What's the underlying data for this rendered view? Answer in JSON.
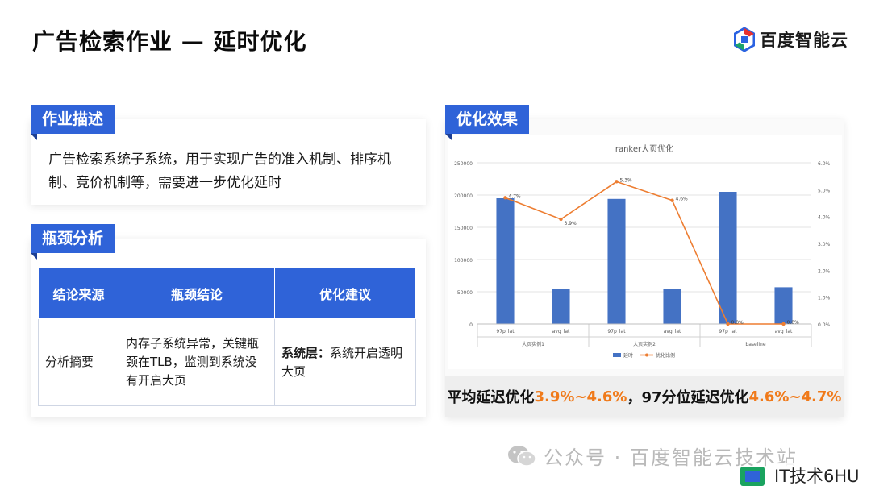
{
  "header": {
    "title": "广告检索作业 — 延时优化"
  },
  "brand": {
    "name": "百度智能云",
    "colors": [
      "#e8312f",
      "#2a62e2",
      "#1ca36b"
    ]
  },
  "description": {
    "tag": "作业描述",
    "text": "广告检索系统子系统，用于实现广告的准入机制、排序机制、竞价机制等，需要进一步优化延时"
  },
  "bottleneck": {
    "tag": "瓶颈分析",
    "headers": [
      "结论来源",
      "瓶颈结论",
      "优化建议"
    ],
    "row": {
      "source": "分析摘要",
      "conclusion": "内存子系统异常，关键瓶颈在TLB，监测到系统没有开启大页",
      "advice_bold": "系统层：",
      "advice_text": "系统开启透明大页"
    }
  },
  "effect": {
    "tag": "优化效果",
    "summary": {
      "p1": "平均延迟优化",
      "v1": "3.9%~4.6%",
      "p2": "，97分位延迟优化",
      "v2": "4.6%~4.7%"
    }
  },
  "chart_data": {
    "type": "bar",
    "title": "ranker大页优化",
    "categories": [
      "97p_lat",
      "avg_lat",
      "97p_lat",
      "avg_lat",
      "97p_lat",
      "avg_lat"
    ],
    "groups": [
      "大页实例1",
      "大页实例2",
      "baseline"
    ],
    "ylim": [
      0,
      250000
    ],
    "y_ticks": [
      0,
      50000,
      100000,
      150000,
      200000,
      250000
    ],
    "y2lim": [
      0,
      6.0
    ],
    "y2_ticks": [
      "0.0%",
      "1.0%",
      "2.0%",
      "3.0%",
      "4.0%",
      "5.0%",
      "6.0%"
    ],
    "series": [
      {
        "name": "延时",
        "kind": "bar",
        "color": "#4472c4",
        "values": [
          195000,
          55000,
          194000,
          54000,
          205000,
          57000
        ]
      },
      {
        "name": "优化比例",
        "kind": "line",
        "axis": "right",
        "color": "#ed7d31",
        "values": [
          4.7,
          3.9,
          5.3,
          4.6,
          0.0,
          0.0
        ],
        "labels": [
          "4.7%",
          "3.9%",
          "5.3%",
          "4.6%",
          "0.0%",
          "0.0%"
        ]
      }
    ],
    "legend": "bottom"
  },
  "watermark": {
    "text": "公众号 · 百度智能云技术站"
  },
  "badge": {
    "text": "IT技术6HU"
  }
}
